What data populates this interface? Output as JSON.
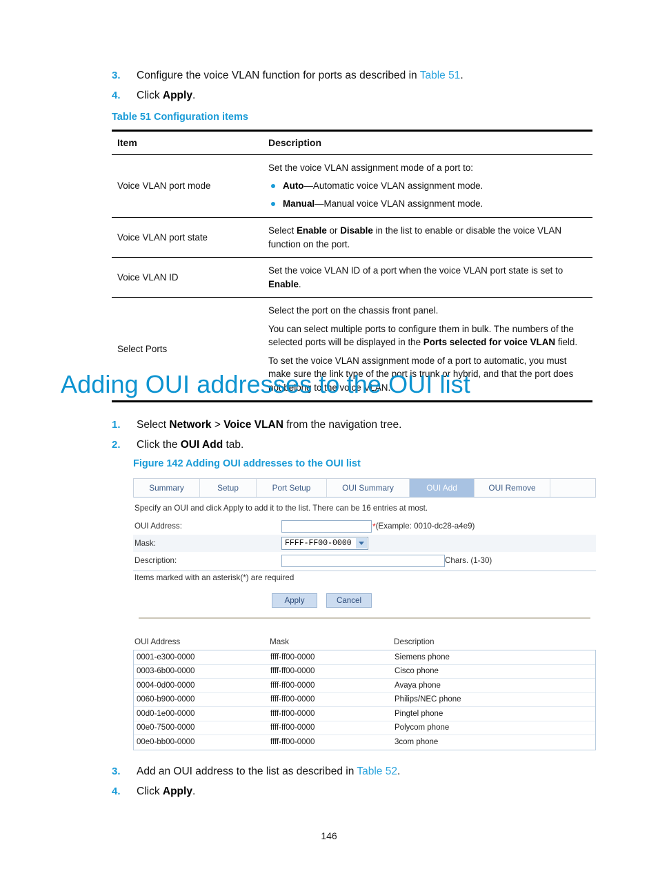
{
  "steps_top": [
    {
      "num": "3.",
      "parts": [
        {
          "t": "Configure the voice VLAN function for ports as described in ",
          "s": "plain"
        },
        {
          "t": "Table 51",
          "s": "link"
        },
        {
          "t": ".",
          "s": "plain"
        }
      ]
    },
    {
      "num": "4.",
      "parts": [
        {
          "t": "Click ",
          "s": "plain"
        },
        {
          "t": "Apply",
          "s": "bold"
        },
        {
          "t": ".",
          "s": "plain"
        }
      ]
    }
  ],
  "table51": {
    "caption": "Table 51 Configuration items",
    "headers": [
      "Item",
      "Description"
    ],
    "rows": [
      {
        "item": "Voice VLAN port mode",
        "intro": "Set the voice VLAN assignment mode of a port to:",
        "bullets": [
          {
            "term": "Auto",
            "rest": "—Automatic voice VLAN assignment mode."
          },
          {
            "term": "Manual",
            "rest": "—Manual voice VLAN assignment mode."
          }
        ]
      },
      {
        "item": "Voice VLAN port state",
        "desc_pre": "Select ",
        "desc_b1": "Enable",
        "desc_mid": " or ",
        "desc_b2": "Disable",
        "desc_post": " in the list to enable or disable the voice VLAN function on the port."
      },
      {
        "item": "Voice VLAN ID",
        "desc_pre": "Set the voice VLAN ID of a port when the voice VLAN port state is set to ",
        "desc_b1": "Enable",
        "desc_post": "."
      },
      {
        "item": "Select Ports",
        "p1": "Select the port on the chassis front panel.",
        "p2_pre": "You can select multiple ports to configure them in bulk. The numbers of the selected ports will be displayed in the ",
        "p2_b": "Ports selected for voice VLAN",
        "p2_post": " field.",
        "p3": "To set the voice VLAN assignment mode of a port to automatic, you must make sure the link type of the port is trunk or hybrid, and that the port does not belong to the voice VLAN."
      }
    ]
  },
  "heading": "Adding OUI addresses to the OUI list",
  "steps_mid": [
    {
      "num": "1.",
      "parts": [
        {
          "t": "Select ",
          "s": "plain"
        },
        {
          "t": "Network",
          "s": "bold"
        },
        {
          "t": " > ",
          "s": "plain"
        },
        {
          "t": "Voice VLAN",
          "s": "bold"
        },
        {
          "t": " from the navigation tree.",
          "s": "plain"
        }
      ]
    },
    {
      "num": "2.",
      "parts": [
        {
          "t": "Click the ",
          "s": "plain"
        },
        {
          "t": "OUI Add",
          "s": "bold"
        },
        {
          "t": " tab.",
          "s": "plain"
        }
      ]
    }
  ],
  "figure": {
    "caption": "Figure 142 Adding OUI addresses to the OUI list",
    "tabs": [
      {
        "label": "Summary",
        "active": false
      },
      {
        "label": "Setup",
        "active": false
      },
      {
        "label": "Port Setup",
        "active": false
      },
      {
        "label": "OUI Summary",
        "active": false
      },
      {
        "label": "OUI Add",
        "active": true
      },
      {
        "label": "OUI Remove",
        "active": false
      }
    ],
    "instruction": "Specify an OUI and click Apply to add it to the list. There can be 16 entries at most.",
    "form": {
      "oui_label": "OUI Address:",
      "oui_value": "",
      "oui_hint": "(Example: 0010-dc28-a4e9)",
      "required_mark": "*",
      "mask_label": "Mask:",
      "mask_value": "FFFF-FF00-0000",
      "desc_label": "Description:",
      "desc_value": "",
      "desc_hint": "Chars. (1-30)",
      "note": "Items marked with an asterisk(*) are required",
      "apply_label": "Apply",
      "cancel_label": "Cancel"
    },
    "list": {
      "headers": [
        "OUI Address",
        "Mask",
        "Description"
      ],
      "rows": [
        [
          "0001-e300-0000",
          "ffff-ff00-0000",
          "Siemens phone"
        ],
        [
          "0003-6b00-0000",
          "ffff-ff00-0000",
          "Cisco phone"
        ],
        [
          "0004-0d00-0000",
          "ffff-ff00-0000",
          "Avaya phone"
        ],
        [
          "0060-b900-0000",
          "ffff-ff00-0000",
          "Philips/NEC phone"
        ],
        [
          "00d0-1e00-0000",
          "ffff-ff00-0000",
          "Pingtel phone"
        ],
        [
          "00e0-7500-0000",
          "ffff-ff00-0000",
          "Polycom phone"
        ],
        [
          "00e0-bb00-0000",
          "ffff-ff00-0000",
          "3com phone"
        ]
      ]
    }
  },
  "steps_bottom": [
    {
      "num": "3.",
      "parts": [
        {
          "t": "Add an OUI address to the list as described in ",
          "s": "plain"
        },
        {
          "t": "Table 52",
          "s": "link"
        },
        {
          "t": ".",
          "s": "plain"
        }
      ]
    },
    {
      "num": "4.",
      "parts": [
        {
          "t": "Click ",
          "s": "plain"
        },
        {
          "t": "Apply",
          "s": "bold"
        },
        {
          "t": ".",
          "s": "plain"
        }
      ]
    }
  ],
  "page_number": "146",
  "colors": {
    "accent_blue": "#1a9bd7",
    "heading_blue": "#0d93d0",
    "link_blue": "#2aa3dd",
    "tab_active_bg": "#a8c2e2",
    "button_bg": "#ccdcf0",
    "required_red": "#e02020"
  }
}
